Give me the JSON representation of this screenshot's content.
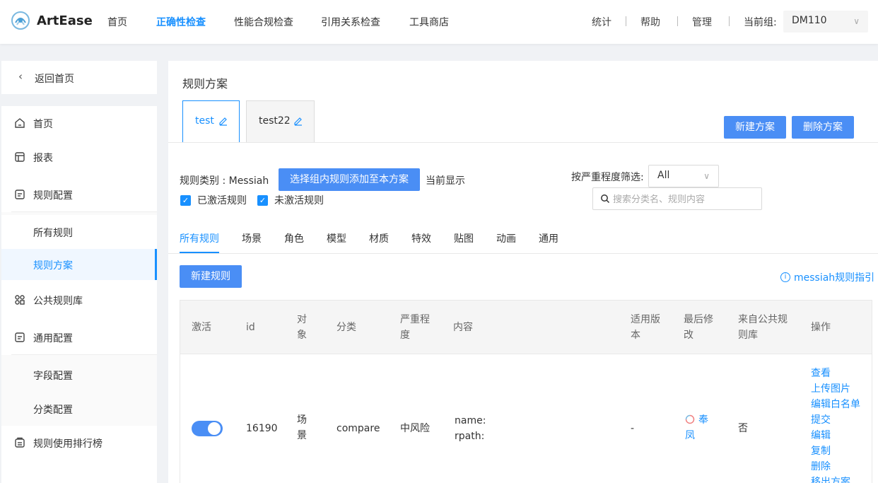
{
  "app": {
    "name": "ArtEase"
  },
  "nav": {
    "items": [
      {
        "label": "首页"
      },
      {
        "label": "正确性检查"
      },
      {
        "label": "性能合规检查"
      },
      {
        "label": "引用关系检查"
      },
      {
        "label": "工具商店"
      }
    ],
    "active_index": 1,
    "right_links": [
      "统计",
      "帮助",
      "管理"
    ],
    "group_label": "当前组:",
    "group_value": "DM110"
  },
  "sidebar": {
    "back_label": "返回首页",
    "items": [
      {
        "label": "首页",
        "icon": "home-icon"
      },
      {
        "label": "报表",
        "icon": "report-icon"
      },
      {
        "label": "规则配置",
        "icon": "config-icon"
      },
      {
        "label": "所有规则"
      },
      {
        "label": "规则方案",
        "active": true
      },
      {
        "label": "公共规则库",
        "icon": "grid-icon"
      },
      {
        "label": "通用配置",
        "icon": "config-icon"
      },
      {
        "label": "字段配置"
      },
      {
        "label": "分类配置"
      },
      {
        "label": "规则使用排行榜",
        "icon": "rank-icon"
      }
    ]
  },
  "main": {
    "title": "规则方案",
    "plan_tabs": [
      {
        "label": "test"
      },
      {
        "label": "test22"
      }
    ],
    "new_plan_label": "新建方案",
    "delete_plan_label": "删除方案",
    "category_label": "规则类别 : Messiah",
    "add_from_group_label": "选择组内规则添加至本方案",
    "now_showing_label": "当前显示",
    "checkbox_active_label": "已激活规则",
    "checkbox_inactive_label": "未激活规则",
    "severity_filter_label": "按严重程度筛选:",
    "severity_value": "All",
    "search_placeholder": "搜索分类名、规则内容",
    "category_tabs": [
      "所有规则",
      "场景",
      "角色",
      "模型",
      "材质",
      "特效",
      "贴图",
      "动画",
      "通用"
    ],
    "new_rule_label": "新建规则",
    "guide_label": "messiah规则指引"
  },
  "table": {
    "headers": {
      "active": "激活",
      "id": "id",
      "object": [
        "对",
        "象"
      ],
      "category": "分类",
      "severity": [
        "严重程",
        "度"
      ],
      "content": "内容",
      "version": [
        "适用版",
        "本"
      ],
      "last_modified": [
        "最后修",
        "改"
      ],
      "from_public": [
        "来自公共规",
        "则库"
      ],
      "actions": "操作"
    },
    "rows": [
      {
        "active": true,
        "id": "16190",
        "object": [
          "场",
          "景"
        ],
        "category": "compare",
        "severity": "中风险",
        "content": [
          "name:",
          "rpath:"
        ],
        "version": "-",
        "last_modified": [
          "奉",
          "凤"
        ],
        "from_public": "否",
        "actions": [
          "查看",
          "上传图片",
          "编辑白名单",
          "提交",
          "编辑",
          "复制",
          "删除",
          "移出方案"
        ]
      }
    ]
  }
}
